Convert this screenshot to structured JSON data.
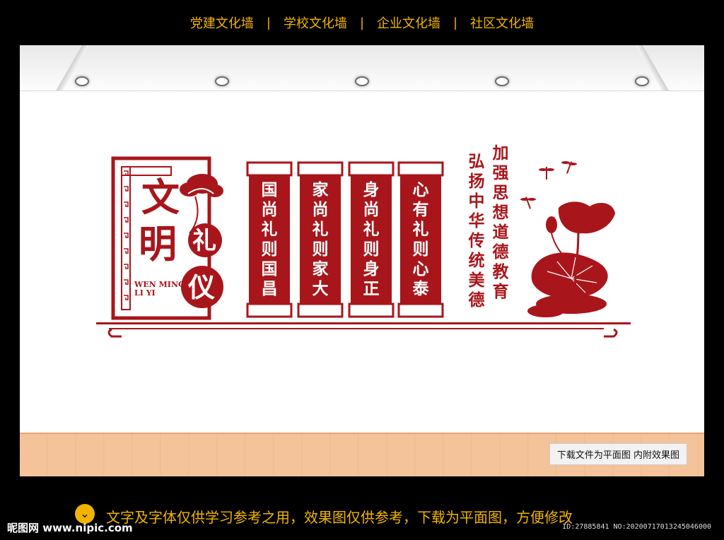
{
  "nav": {
    "items": [
      "党建文化墙",
      "学校文化墙",
      "企业文化墙",
      "社区文化墙"
    ],
    "separator": "|"
  },
  "panel": {
    "title_char1": "文",
    "title_char2": "明",
    "circle_char1": "礼",
    "circle_char2": "仪",
    "pinyin_line1": "WEN MING",
    "pinyin_line2": "LI YI"
  },
  "scrolls": [
    "国尚礼则国昌",
    "家尚礼则家大",
    "身尚礼则身正",
    "心有礼则心泰"
  ],
  "slogans": [
    "弘扬中华传统美德",
    "加强思想道德教育"
  ],
  "note": "下载文件为平面图 内附效果图",
  "footer": {
    "notice": "文字及字体仅供学习参考之用，效果图仅供参考，下载为平面图，方便修改",
    "logo": "昵图网 www.nipic.com",
    "id": "ID:27885841 NO:20200717013245046000"
  },
  "colors": {
    "accent": "#a8161b",
    "nav_text": "#f0b400"
  }
}
